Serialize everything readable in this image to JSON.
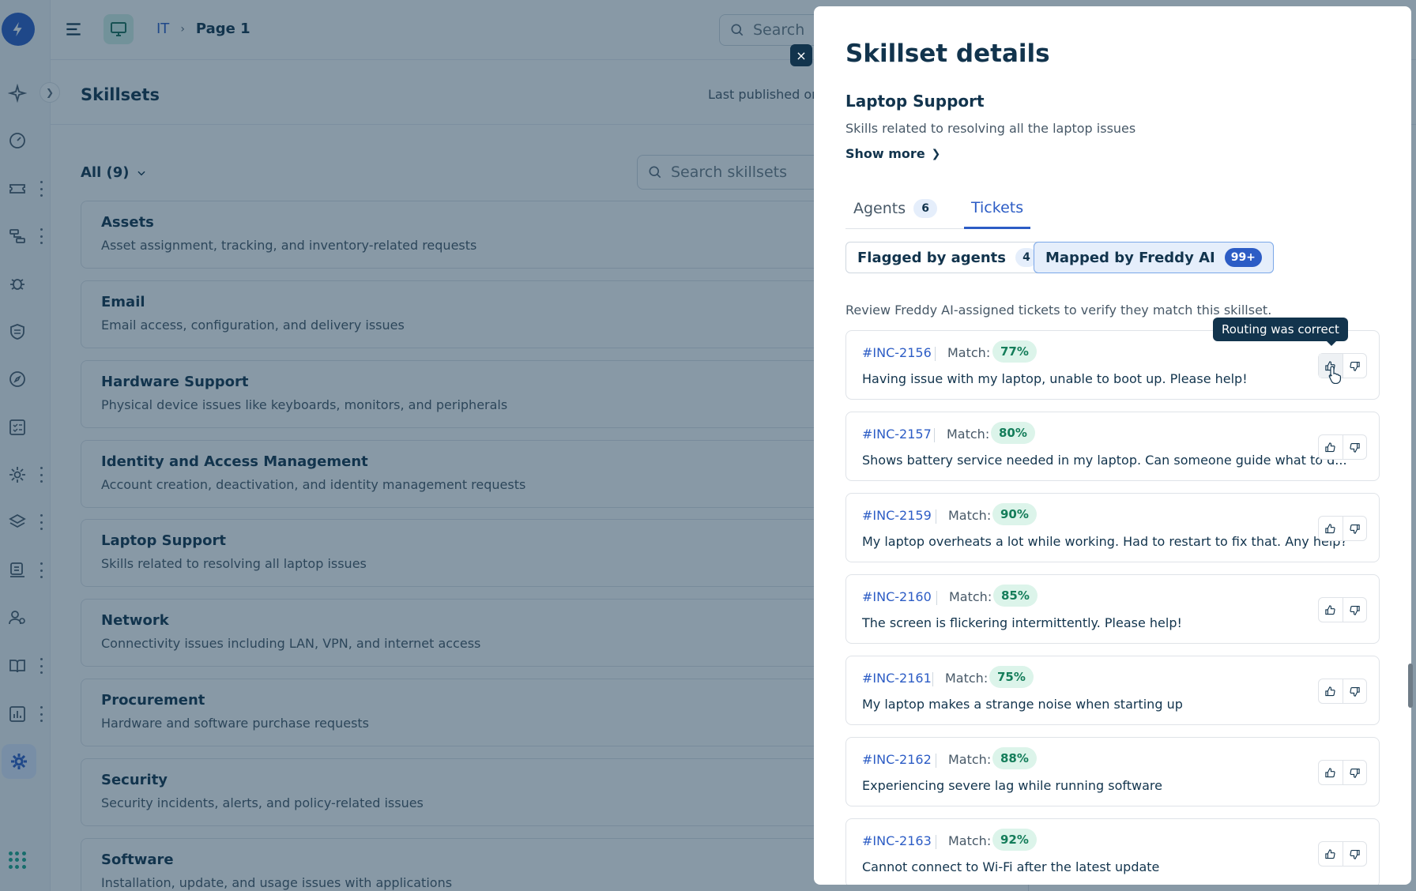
{
  "breadcrumb": {
    "root": "IT",
    "current": "Page 1"
  },
  "top_search": {
    "placeholder": "Search"
  },
  "page": {
    "title": "Skillsets",
    "published": "Last published on"
  },
  "filter": {
    "label": "All (9)"
  },
  "skill_search": {
    "placeholder": "Search skillsets"
  },
  "skillsets": [
    {
      "name": "Assets",
      "description": "Asset assignment, tracking, and inventory-related requests"
    },
    {
      "name": "Email",
      "description": "Email access, configuration, and delivery issues"
    },
    {
      "name": "Hardware Support",
      "description": "Physical device issues like keyboards, monitors, and peripherals"
    },
    {
      "name": "Identity and Access Management",
      "description": "Account creation, deactivation, and identity management requests"
    },
    {
      "name": "Laptop Support",
      "description": "Skills related to resolving all laptop issues"
    },
    {
      "name": "Network",
      "description": "Connectivity issues including LAN, VPN, and internet access"
    },
    {
      "name": "Procurement",
      "description": "Hardware and software purchase requests"
    },
    {
      "name": "Security",
      "description": "Security incidents, alerts, and policy-related issues"
    },
    {
      "name": "Software",
      "description": "Installation, update, and usage issues with applications"
    }
  ],
  "drawer": {
    "close": "×",
    "title": "Skillset details",
    "skill_name": "Laptop Support",
    "skill_desc": "Skills related to resolving all the laptop issues",
    "show_more": "Show more",
    "tabs": [
      {
        "label": "Agents",
        "count": "6"
      },
      {
        "label": "Tickets"
      }
    ],
    "subtabs": [
      {
        "label": "Flagged by agents",
        "count": "4"
      },
      {
        "label": "Mapped by Freddy AI",
        "count": "99+"
      }
    ],
    "review_text": "Review Freddy AI-assigned tickets to verify they match this skillset.",
    "tooltip": "Routing was correct",
    "match_label": "Match:",
    "tickets": [
      {
        "id": "#INC-2156",
        "match": "77%",
        "text": "Having issue with my laptop, unable to boot up. Please help!"
      },
      {
        "id": "#INC-2157",
        "match": "80%",
        "text": "Shows battery service needed in my laptop. Can someone guide what to d..."
      },
      {
        "id": "#INC-2159",
        "match": "90%",
        "text": "My laptop overheats a lot while working. Had to restart to fix that. Any help?"
      },
      {
        "id": "#INC-2160",
        "match": "85%",
        "text": "The screen is flickering intermittently. Please help!"
      },
      {
        "id": "#INC-2161",
        "match": "75%",
        "text": "My laptop makes a strange noise when starting up"
      },
      {
        "id": "#INC-2162",
        "match": "88%",
        "text": "Experiencing severe lag while running software"
      },
      {
        "id": "#INC-2163",
        "match": "92%",
        "text": "Cannot connect to Wi-Fi after the latest update"
      }
    ]
  },
  "colors": {
    "brand": "#2c5cc5",
    "match_badge": "#dcf4ea",
    "overlay": "#12344d"
  },
  "icons": {
    "logo": "freshservice-bolt-icon",
    "nav": [
      "sparkle-icon",
      "dashboard-icon",
      "ticket-icon",
      "workflow-icon",
      "bug-icon",
      "shield-icon",
      "compass-icon",
      "checklist-icon",
      "gear-cog-icon",
      "layers-icon",
      "inbox-icon",
      "users-icon",
      "book-icon",
      "chart-icon",
      "settings-icon"
    ],
    "like": "thumbs-up-icon",
    "dislike": "thumbs-down-icon"
  }
}
